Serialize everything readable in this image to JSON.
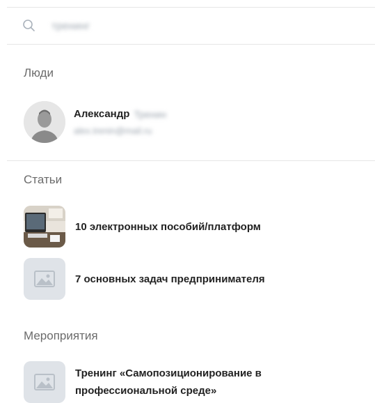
{
  "search": {
    "query": "тренинг",
    "icon": "search-icon"
  },
  "sections": {
    "people": {
      "title": "Люди",
      "items": [
        {
          "first_name": "Александр",
          "last_name": "Тренин",
          "email": "alex.trenin@mail.ru"
        }
      ]
    },
    "articles": {
      "title": "Статьи",
      "items": [
        {
          "title": "10 электронных пособий/платформ",
          "thumb": "photo"
        },
        {
          "title": "7 основных задач предпринимателя",
          "thumb": "image-placeholder-icon"
        }
      ]
    },
    "events": {
      "title": "Мероприятия",
      "items": [
        {
          "title_line1": "Тренинг «Самопозиционирование в",
          "title_line2": "профессиональной среде»",
          "thumb": "image-placeholder-icon"
        }
      ]
    }
  },
  "colors": {
    "divider": "#e6e6e6",
    "section_title": "#6b6b6b",
    "placeholder_bg": "#dfe3e8",
    "placeholder_icon": "#b9c0c8"
  }
}
